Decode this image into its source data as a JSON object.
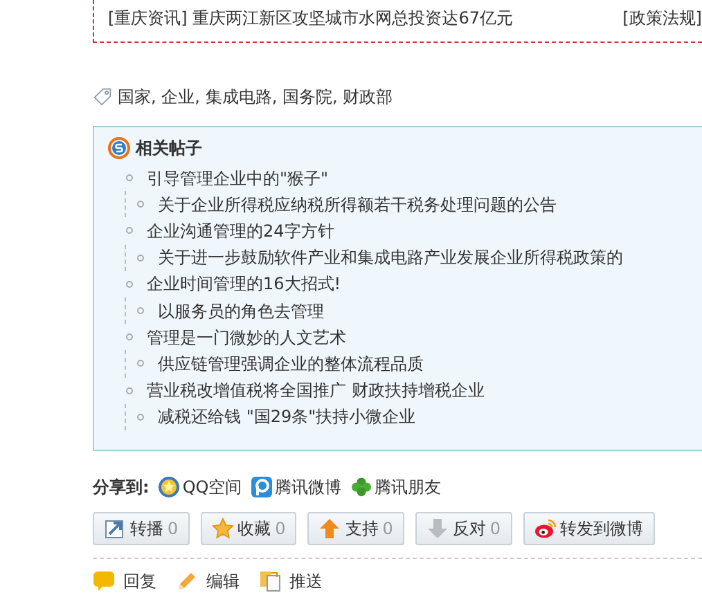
{
  "news_line": {
    "category": "[重庆资讯]",
    "title": "重庆两江新区攻坚城市水网总投资达67亿元",
    "section": "[政策法规]"
  },
  "tags": [
    "国家,",
    "企业,",
    "集成电路,",
    "国务院,",
    "财政部"
  ],
  "related": {
    "title": "相关帖子",
    "items": [
      "引导管理企业中的\"猴子\"",
      "关于企业所得税应纳税所得额若干税务处理问题的公告",
      "企业沟通管理的24字方针",
      "关于进一步鼓励软件产业和集成电路产业发展企业所得税政策的",
      "企业时间管理的16大招式!",
      "以服务员的角色去管理",
      "管理是一门微妙的人文艺术",
      "供应链管理强调企业的整体流程品质",
      "营业税改增值税将全国推广 财政扶持增税企业",
      "减税还给钱 \"国29条\"扶持小微企业"
    ]
  },
  "share": {
    "label": "分享到:",
    "targets": [
      {
        "kind": "qzone",
        "label": "QQ空间"
      },
      {
        "kind": "weibo",
        "label": "腾讯微博"
      },
      {
        "kind": "friends",
        "label": "腾讯朋友"
      }
    ]
  },
  "actions": [
    {
      "kind": "forward",
      "label": "转播",
      "count": "0"
    },
    {
      "kind": "favorite",
      "label": "收藏",
      "count": "0"
    },
    {
      "kind": "support",
      "label": "支持",
      "count": "0"
    },
    {
      "kind": "oppose",
      "label": "反对",
      "count": "0"
    },
    {
      "kind": "sina",
      "label": "转发到微博"
    }
  ],
  "post_actions": [
    {
      "kind": "reply",
      "label": "回复"
    },
    {
      "kind": "edit",
      "label": "编辑"
    },
    {
      "kind": "push",
      "label": "推送"
    }
  ]
}
